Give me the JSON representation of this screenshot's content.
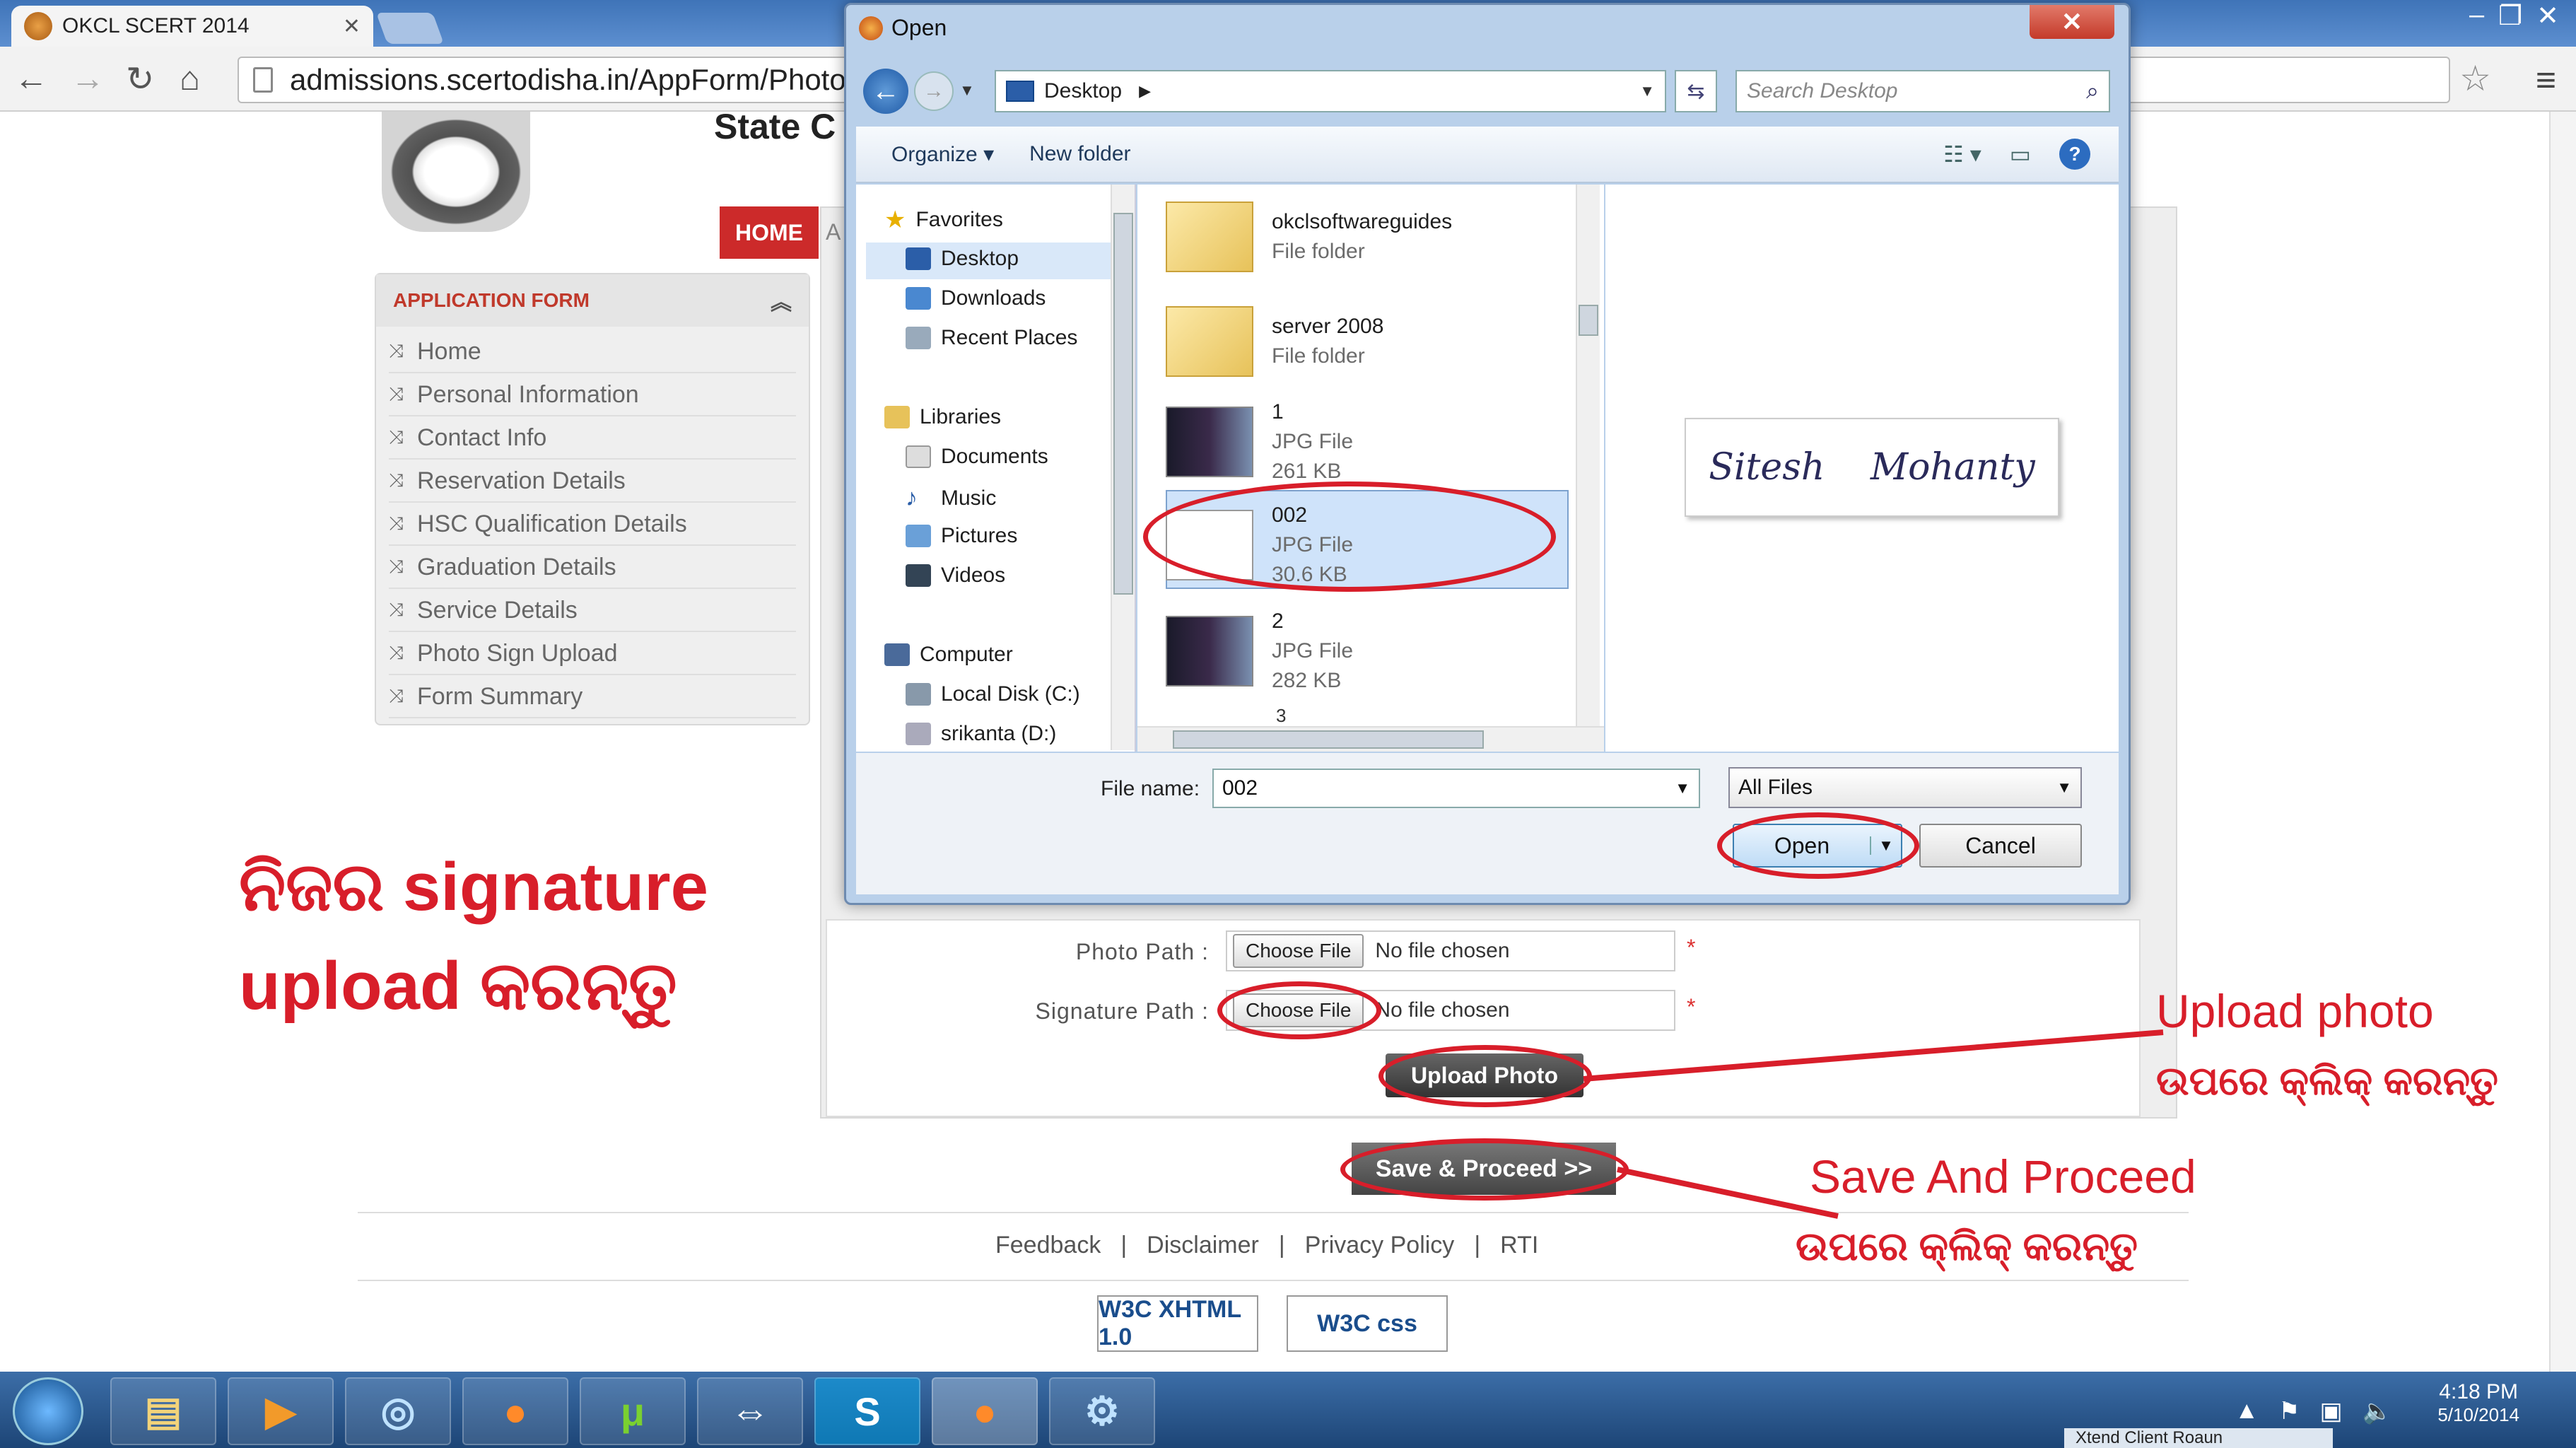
{
  "browser": {
    "tab_title": "OKCL SCERT 2014",
    "url": "admissions.scertodisha.in/AppForm/PhotoS"
  },
  "page": {
    "site_title_partial": "State C",
    "home_button": "HOME",
    "home_next_partial": "A"
  },
  "sidebar": {
    "header": "APPLICATION FORM",
    "items": [
      {
        "label": "Home"
      },
      {
        "label": "Personal Information"
      },
      {
        "label": "Contact Info"
      },
      {
        "label": "Reservation Details"
      },
      {
        "label": "HSC Qualification Details"
      },
      {
        "label": "Graduation Details"
      },
      {
        "label": "Service Details"
      },
      {
        "label": "Photo Sign Upload"
      },
      {
        "label": "Form Summary"
      }
    ]
  },
  "form": {
    "photo_label": "Photo Path :",
    "signature_label": "Signature Path :",
    "choose_file": "Choose File",
    "no_file": "No file chosen",
    "required": "*",
    "upload_button": "Upload Photo",
    "save_button": "Save & Proceed >>"
  },
  "footer": {
    "links": [
      "Feedback",
      "Disclaimer",
      "Privacy Policy",
      "RTI"
    ],
    "separator": "|",
    "badge_xhtml": "W3C XHTML 1.0",
    "badge_css": "W3C css"
  },
  "annotations": {
    "left_line1": "ନିଜର signature",
    "left_line2": "upload କରନ୍ତୁ",
    "upload_line1": "Upload photo",
    "upload_line2": "ଉପରେ  କ୍ଲିକ୍ କରନ୍ତୁ",
    "save_line1": "Save And Proceed",
    "save_line2": "ଉପରେ କ୍ଲିକ୍ କରନ୍ତୁ"
  },
  "dialog": {
    "title": "Open",
    "location": "Desktop",
    "search_placeholder": "Search Desktop",
    "organize": "Organize",
    "new_folder": "New folder",
    "nav": {
      "favorites": "Favorites",
      "desktop": "Desktop",
      "downloads": "Downloads",
      "recent_places": "Recent Places",
      "libraries": "Libraries",
      "documents": "Documents",
      "music": "Music",
      "pictures": "Pictures",
      "videos": "Videos",
      "computer": "Computer",
      "local_disk": "Local Disk (C:)",
      "srikanta": "srikanta (D:)"
    },
    "files": [
      {
        "name": "okclsoftwareguides",
        "type": "File folder",
        "size": ""
      },
      {
        "name": "server 2008",
        "type": "File folder",
        "size": ""
      },
      {
        "name": "1",
        "type": "JPG File",
        "size": "261 KB"
      },
      {
        "name": "002",
        "type": "JPG File",
        "size": "30.6 KB"
      },
      {
        "name": "2",
        "type": "JPG File",
        "size": "282 KB"
      }
    ],
    "partial_item": "3",
    "preview_word1": "Sitesh",
    "preview_word2": "Mohanty",
    "file_name_label": "File name:",
    "file_name_value": "002",
    "filter": "All Files",
    "open_button": "Open",
    "cancel_button": "Cancel"
  },
  "taskbar": {
    "time": "4:18 PM",
    "date_partial": "5/10/2014",
    "partial_window": "Xtend Client Roaun"
  },
  "colors": {
    "annotation_red": "#d81e2a",
    "home_red": "#cc2a2a",
    "sidebar_header": "#c0392b"
  }
}
